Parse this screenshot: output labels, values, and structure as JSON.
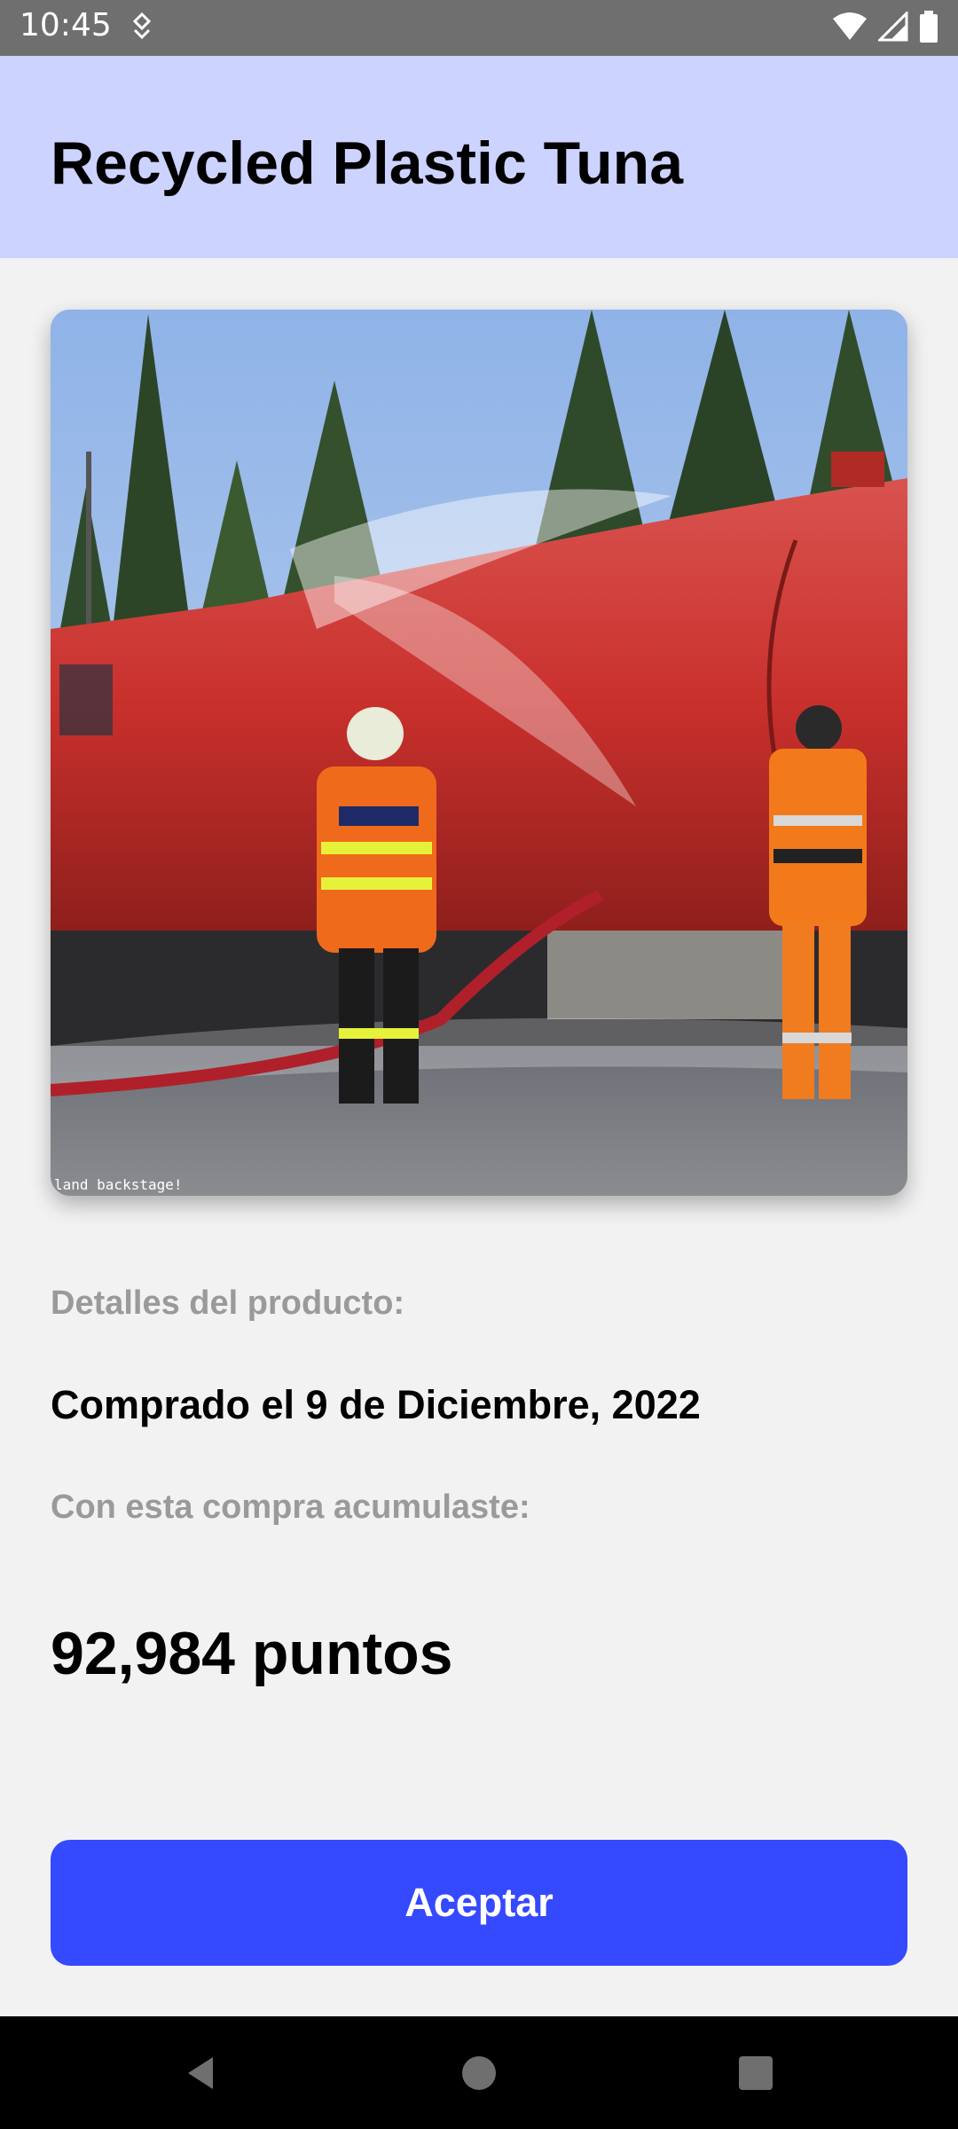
{
  "status_bar": {
    "time": "10:45",
    "left_icon": "nfc-location-icon",
    "right_icons": [
      "wifi-icon",
      "signal-icon",
      "battery-icon"
    ]
  },
  "header": {
    "title": "Recycled Plastic Tuna",
    "background": "#cdd3ff"
  },
  "product_image": {
    "description_icon": "product-photo",
    "watermark": "land backstage!"
  },
  "details": {
    "label": "Detalles del producto:",
    "purchase_date": "Comprado el 9 de Diciembre, 2022",
    "accumulated_label": "Con esta compra acumulaste:",
    "points": "92,984 puntos"
  },
  "actions": {
    "accept_label": "Aceptar",
    "accent": "#3549ff"
  },
  "nav_bar": {
    "buttons": [
      "back-icon",
      "home-icon",
      "recents-icon"
    ]
  }
}
